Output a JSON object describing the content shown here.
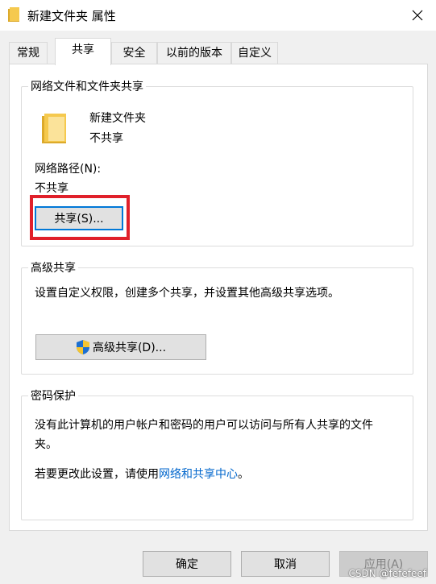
{
  "window": {
    "title": "新建文件夹 属性",
    "close_icon": "close-icon"
  },
  "tabs": [
    {
      "label": "常规",
      "active": false
    },
    {
      "label": "共享",
      "active": true
    },
    {
      "label": "安全",
      "active": false
    },
    {
      "label": "以前的版本",
      "active": false
    },
    {
      "label": "自定义",
      "active": false
    }
  ],
  "network_sharing": {
    "group_title": "网络文件和文件夹共享",
    "folder_name": "新建文件夹",
    "folder_status": "不共享",
    "network_path_label": "网络路径(N):",
    "network_path_value": "不共享",
    "share_button": "共享(S)...",
    "highlight_color": "#e0202a"
  },
  "advanced_sharing": {
    "group_title": "高级共享",
    "description": "设置自定义权限，创建多个共享，并设置其他高级共享选项。",
    "button": "高级共享(D)...",
    "button_icon": "uac-shield-icon"
  },
  "password_protection": {
    "group_title": "密码保护",
    "description_line1": "没有此计算机的用户帐户和密码的用户可以访问与所有人共享的文件",
    "description_line2": "夹。",
    "change_prefix": "若要更改此设置，请使用",
    "change_link": "网络和共享中心",
    "change_suffix": "。"
  },
  "footer": {
    "ok": "确定",
    "cancel": "取消",
    "apply": "应用(A)"
  },
  "watermark": "CSDN @fefefeef",
  "colors": {
    "accent": "#0078d7",
    "link": "#0066cc",
    "highlight": "#e0202a",
    "folder": "#f5c94e"
  }
}
